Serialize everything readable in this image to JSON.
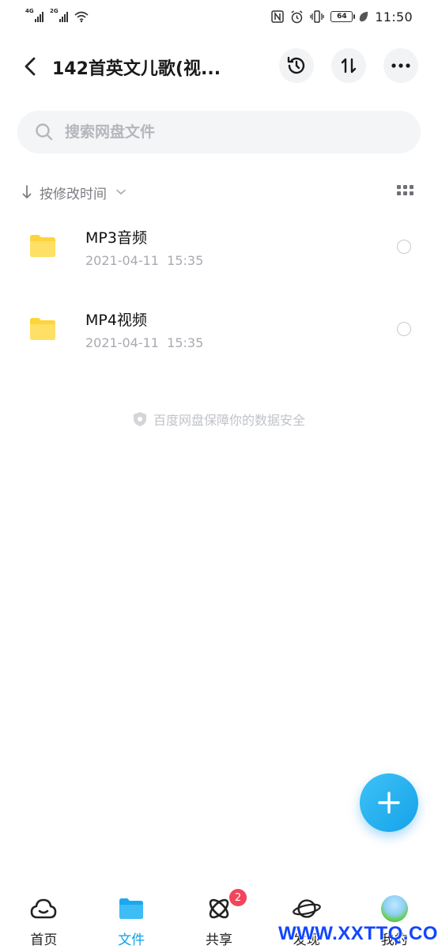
{
  "status_bar": {
    "signal1_label": "4G",
    "signal2_label": "2G",
    "battery": "64",
    "time": "11:50"
  },
  "header": {
    "title": "142首英文儿歌(视...",
    "back_icon": "chevron-left-icon",
    "history_icon": "history-icon",
    "sort_icon": "sort-toggle-icon",
    "more_icon": "more-icon"
  },
  "search": {
    "placeholder": "搜索网盘文件",
    "value": ""
  },
  "sort": {
    "label": "按修改时间"
  },
  "files": [
    {
      "name": "MP3音频",
      "date": "2021-04-11  15:35"
    },
    {
      "name": "MP4视频",
      "date": "2021-04-11  15:35"
    }
  ],
  "footer_note": "百度网盘保障你的数据安全",
  "bottom_nav": {
    "items": [
      {
        "label": "首页",
        "icon": "cloud-home-icon"
      },
      {
        "label": "文件",
        "icon": "folder-icon"
      },
      {
        "label": "共享",
        "icon": "share-atom-icon"
      },
      {
        "label": "发现",
        "icon": "planet-icon"
      },
      {
        "label": "我的",
        "icon": "avatar-icon"
      }
    ],
    "share_badge": "2"
  },
  "watermark": "WWW.XXTTQ.COM",
  "colors": {
    "accent": "#0aa2ea",
    "folder": "#ffd43b",
    "badge": "#f2455c",
    "watermark": "#1346ff"
  }
}
